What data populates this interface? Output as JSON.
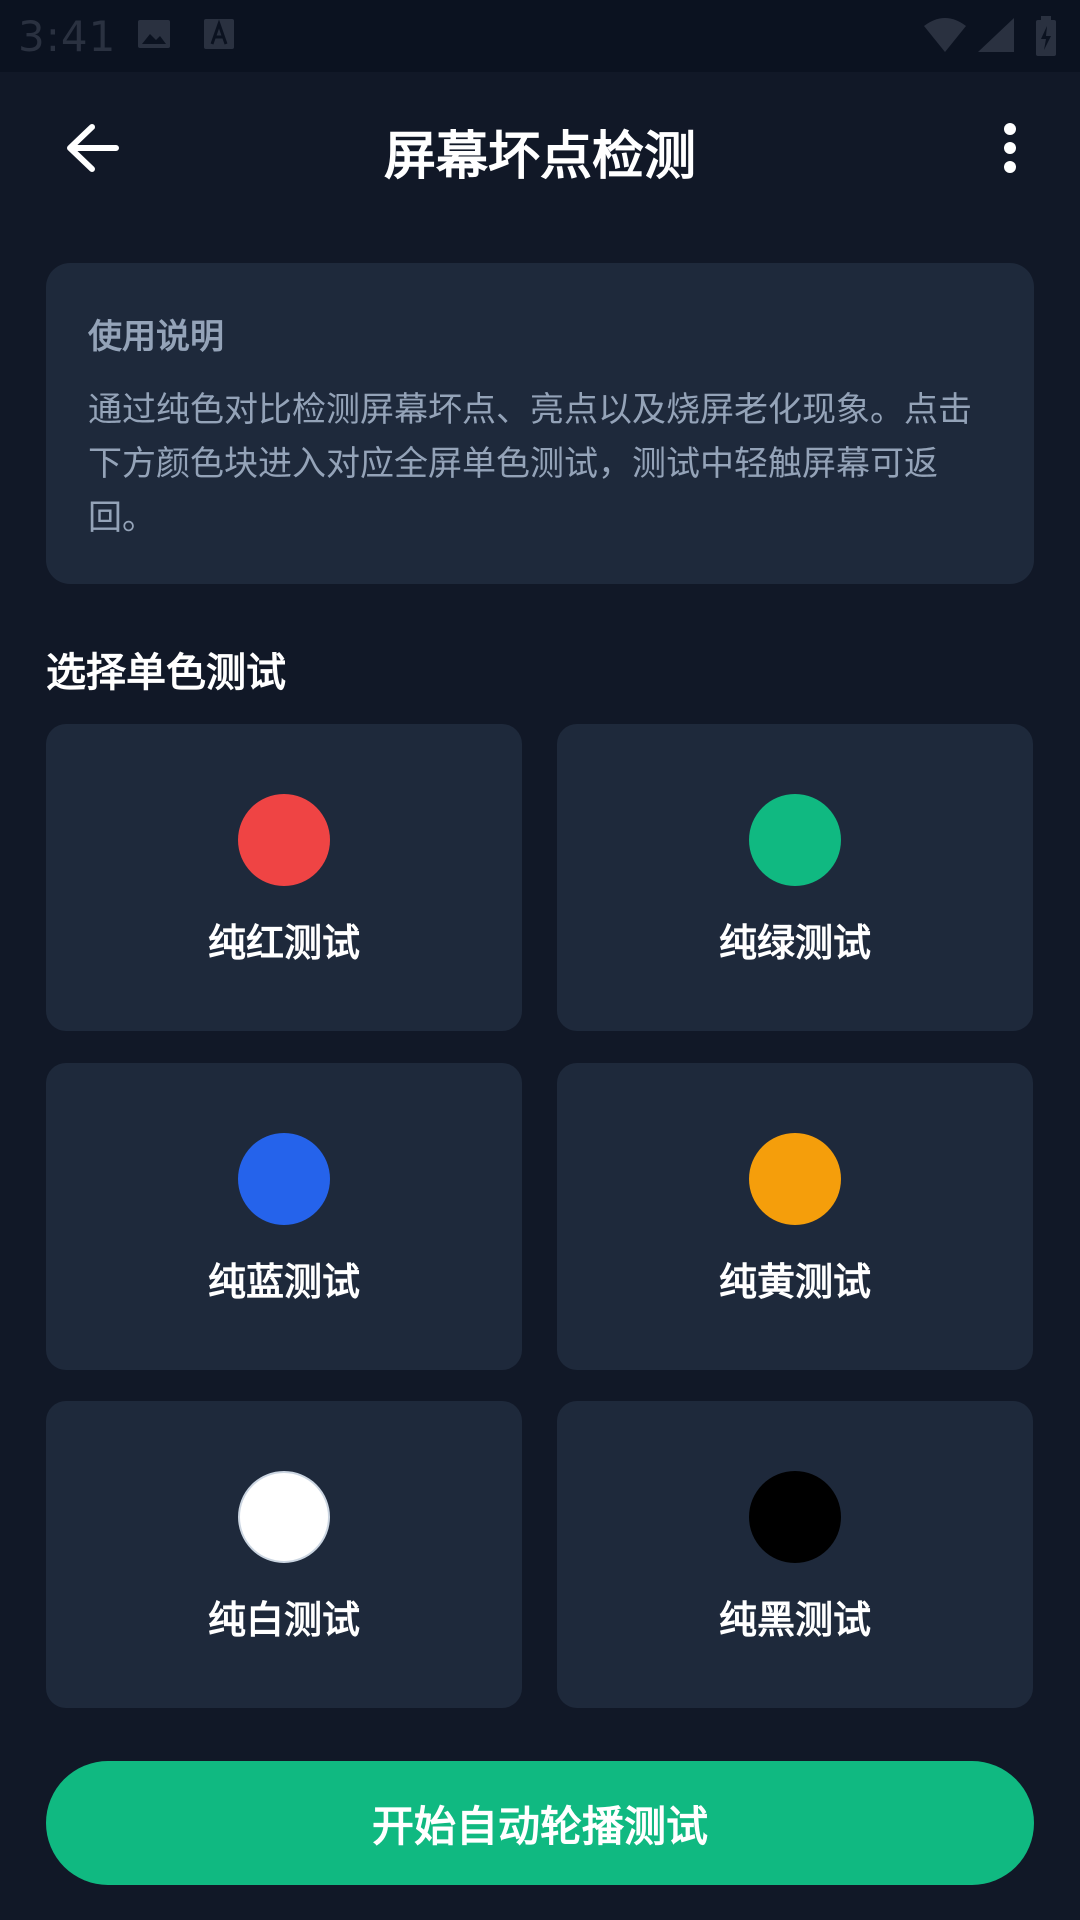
{
  "status_bar": {
    "time": "3:41",
    "icons": [
      "image-icon",
      "text-icon",
      "wifi-icon",
      "signal-icon",
      "battery-icon"
    ]
  },
  "header": {
    "title": "屏幕坏点检测",
    "back_icon": "arrow-left-icon",
    "more_icon": "more-vertical-icon"
  },
  "info": {
    "title": "使用说明",
    "body": "通过纯色对比检测屏幕坏点、亮点以及烧屏老化现象。点击下方颜色块进入对应全屏单色测试，测试中轻触屏幕可返回。"
  },
  "section": {
    "title": "选择单色测试"
  },
  "tests": [
    {
      "label": "纯红测试",
      "color": "#ef4444"
    },
    {
      "label": "纯绿测试",
      "color": "#10b981"
    },
    {
      "label": "纯蓝测试",
      "color": "#2563eb"
    },
    {
      "label": "纯黄测试",
      "color": "#f59e0b"
    },
    {
      "label": "纯白测试",
      "color": "#ffffff"
    },
    {
      "label": "纯黑测试",
      "color": "#000000"
    }
  ],
  "action": {
    "start_label": "开始自动轮播测试",
    "color": "#10b981"
  },
  "theme": {
    "background": "#111827",
    "card": "#1e293b",
    "muted_text": "#94a3b8"
  }
}
